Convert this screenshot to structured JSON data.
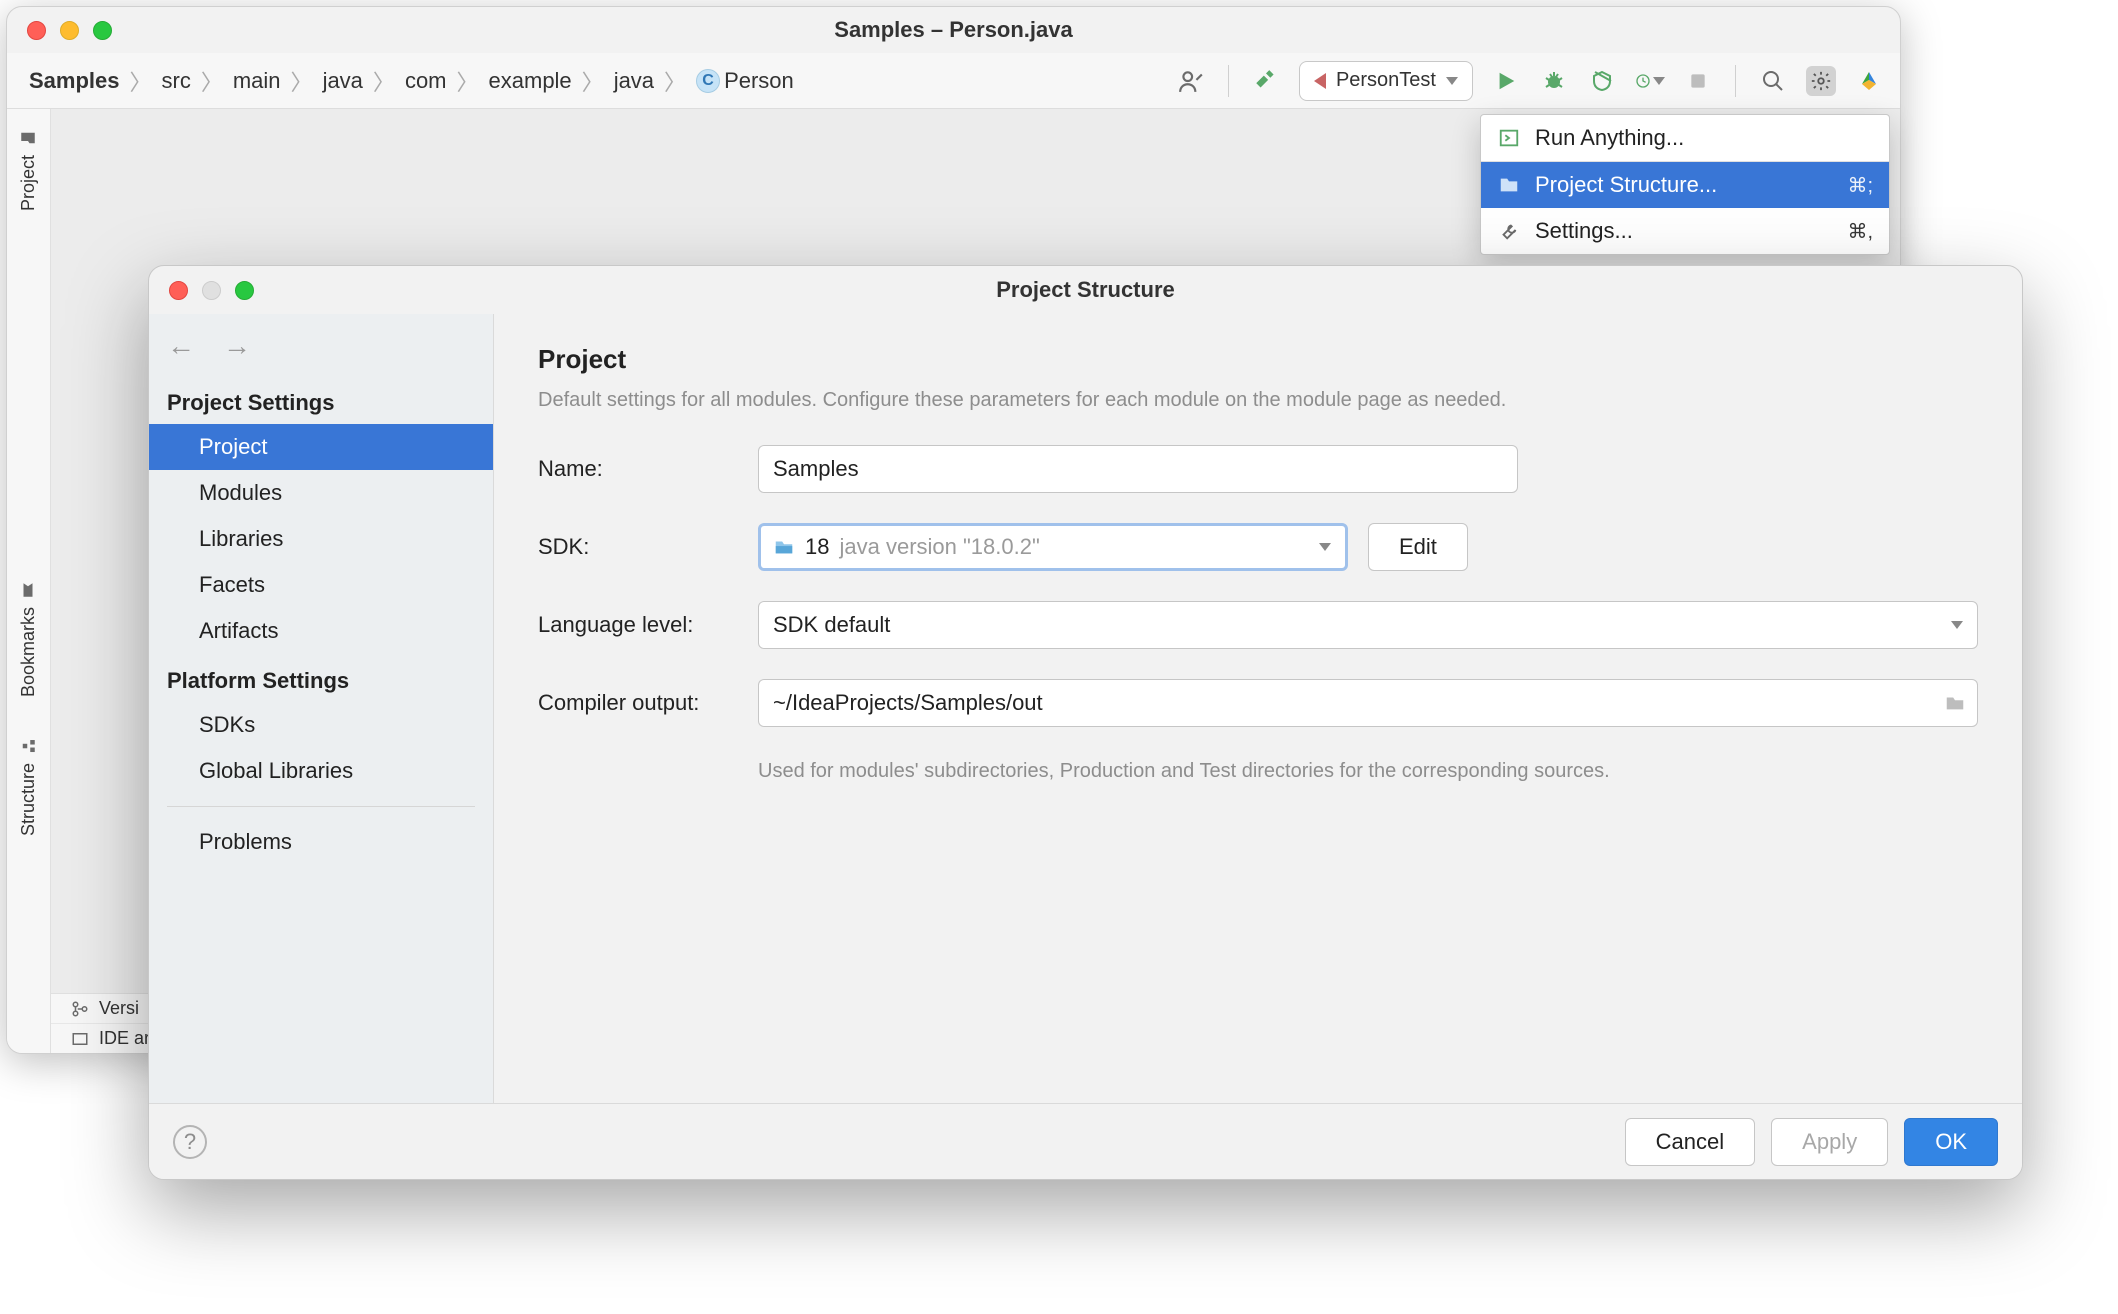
{
  "main": {
    "title": "Samples – Person.java",
    "breadcrumbs": [
      "Samples",
      "src",
      "main",
      "java",
      "com",
      "example",
      "java",
      "Person"
    ],
    "run_config": "PersonTest",
    "side_tabs": {
      "project": "Project",
      "bookmarks": "Bookmarks",
      "structure": "Structure"
    },
    "status1": "Versi",
    "status2": "IDE ar"
  },
  "menu": {
    "items": [
      {
        "label": "Run Anything...",
        "kb": ""
      },
      {
        "label": "Project Structure...",
        "kb": "⌘;"
      },
      {
        "label": "Settings...",
        "kb": "⌘,"
      }
    ]
  },
  "dialog": {
    "title": "Project Structure",
    "sections": {
      "project_settings": "Project Settings",
      "items1": [
        "Project",
        "Modules",
        "Libraries",
        "Facets",
        "Artifacts"
      ],
      "platform_settings": "Platform Settings",
      "items2": [
        "SDKs",
        "Global Libraries"
      ],
      "sep_items": [
        "Problems"
      ]
    },
    "content": {
      "heading": "Project",
      "desc": "Default settings for all modules. Configure these parameters for each module on the module page as needed.",
      "name_label": "Name:",
      "name_value": "Samples",
      "sdk_label": "SDK:",
      "sdk_num": "18",
      "sdk_ver": "java version \"18.0.2\"",
      "edit_btn": "Edit",
      "lang_label": "Language level:",
      "lang_value": "SDK default",
      "out_label": "Compiler output:",
      "out_value": "~/IdeaProjects/Samples/out",
      "out_hint": "Used for modules' subdirectories, Production and Test directories for the corresponding sources."
    },
    "footer": {
      "cancel": "Cancel",
      "apply": "Apply",
      "ok": "OK",
      "help": "?"
    }
  }
}
